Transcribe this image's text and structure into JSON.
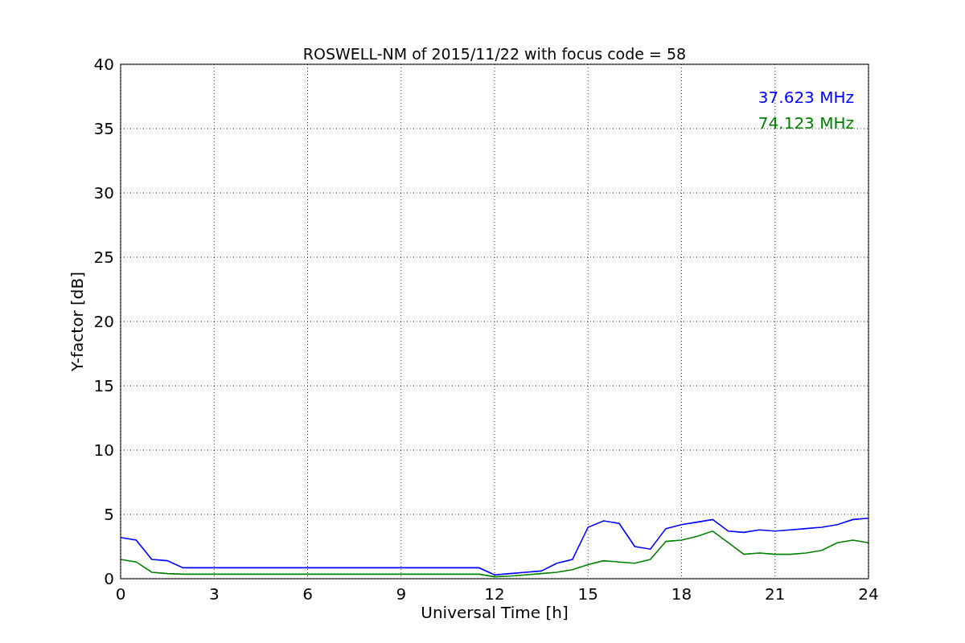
{
  "chart_data": {
    "type": "line",
    "title": "ROSWELL-NM of 2015/11/22 with focus code = 58",
    "xlabel": "Universal Time [h]",
    "ylabel": "Y-factor [dB]",
    "x": [
      0,
      0.5,
      1,
      1.5,
      2,
      2.5,
      3,
      3.5,
      4,
      4.5,
      5,
      5.5,
      6,
      6.5,
      7,
      7.5,
      8,
      8.5,
      9,
      9.5,
      10,
      10.5,
      11,
      11.5,
      12,
      12.5,
      13,
      13.5,
      14,
      14.5,
      15,
      15.5,
      16,
      16.5,
      17,
      17.5,
      18,
      18.5,
      19,
      19.5,
      20,
      20.5,
      21,
      21.5,
      22,
      22.5,
      23,
      23.5,
      24
    ],
    "series": [
      {
        "name": "37.623 MHz",
        "color": "#0000ff",
        "values": [
          3.2,
          3.0,
          1.5,
          1.4,
          0.85,
          0.85,
          0.85,
          0.85,
          0.85,
          0.85,
          0.85,
          0.85,
          0.85,
          0.85,
          0.85,
          0.85,
          0.85,
          0.85,
          0.85,
          0.85,
          0.85,
          0.85,
          0.85,
          0.85,
          0.3,
          0.4,
          0.5,
          0.6,
          1.2,
          1.5,
          4.0,
          4.5,
          4.3,
          2.5,
          2.3,
          3.9,
          4.2,
          4.4,
          4.6,
          3.7,
          3.6,
          3.8,
          3.7,
          3.8,
          3.9,
          4.0,
          4.2,
          4.6,
          4.7
        ]
      },
      {
        "name": "74.123 MHz",
        "color": "#008000",
        "values": [
          1.5,
          1.3,
          0.5,
          0.4,
          0.35,
          0.35,
          0.35,
          0.35,
          0.35,
          0.35,
          0.35,
          0.35,
          0.35,
          0.35,
          0.35,
          0.35,
          0.35,
          0.35,
          0.35,
          0.35,
          0.35,
          0.35,
          0.35,
          0.35,
          0.15,
          0.2,
          0.3,
          0.4,
          0.5,
          0.7,
          1.1,
          1.4,
          1.3,
          1.2,
          1.5,
          2.9,
          3.0,
          3.3,
          3.7,
          2.8,
          1.9,
          2.0,
          1.9,
          1.9,
          2.0,
          2.2,
          2.8,
          3.0,
          2.8
        ]
      }
    ],
    "grid": true,
    "xlim": [
      0,
      24
    ],
    "ylim": [
      0,
      40
    ],
    "xticks": [
      0,
      3,
      6,
      9,
      12,
      15,
      18,
      21,
      24
    ],
    "yticks": [
      0,
      5,
      10,
      15,
      20,
      25,
      30,
      35,
      40
    ]
  }
}
